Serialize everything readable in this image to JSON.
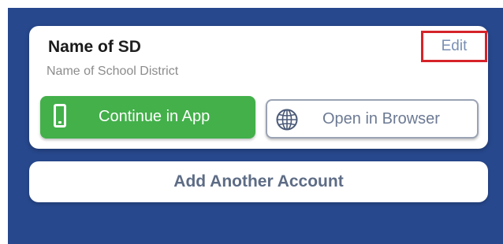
{
  "account": {
    "name_prefix": "Name of",
    "name_suffix": "SD",
    "subtitle": "Name of School District",
    "edit_label": "Edit"
  },
  "actions": {
    "continue_app_label": "Continue in App",
    "continue_app_icon": "phone-icon",
    "open_browser_label": "Open in Browser",
    "open_browser_icon": "globe-icon",
    "add_account_label": "Add Another Account"
  },
  "colors": {
    "background": "#27488d",
    "primary_button": "#43b04a",
    "highlight_box": "#d6232a"
  }
}
